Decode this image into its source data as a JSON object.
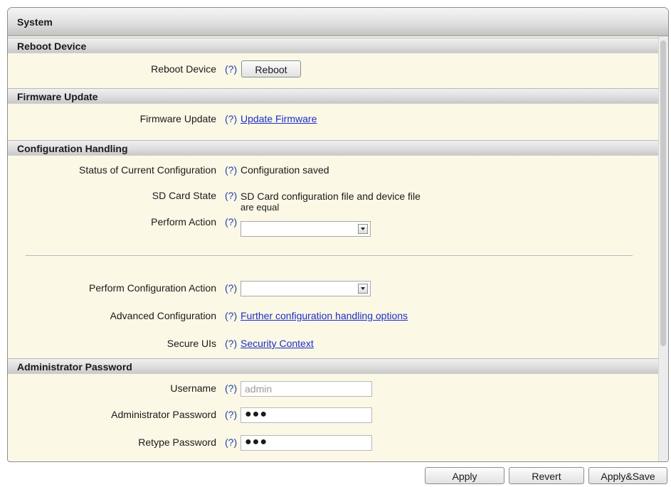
{
  "panel": {
    "title": "System"
  },
  "sections": {
    "reboot": {
      "header": "Reboot Device",
      "label": "Reboot Device",
      "help": "(?)",
      "button": "Reboot"
    },
    "firmware": {
      "header": "Firmware Update",
      "label": "Firmware Update",
      "help": "(?)",
      "link": "Update Firmware"
    },
    "config": {
      "header": "Configuration Handling",
      "status_label": "Status of Current Configuration",
      "status_help": "(?)",
      "status_value": "Configuration saved",
      "sd_label": "SD Card State",
      "sd_help": "(?)",
      "sd_value_line1": "SD Card configuration file and device file",
      "sd_value_line2": "are equal",
      "perform_label": "Perform Action",
      "perform_help": "(?)",
      "perform_value": "",
      "perform_config_label": "Perform Configuration Action",
      "perform_config_help": "(?)",
      "perform_config_value": "",
      "advanced_label": "Advanced Configuration",
      "advanced_help": "(?)",
      "advanced_link": "Further configuration handling options",
      "secure_label": "Secure UIs",
      "secure_help": "(?)",
      "secure_link": "Security Context"
    },
    "admin": {
      "header": "Administrator Password",
      "username_label": "Username",
      "username_help": "(?)",
      "username_value": "admin",
      "password_label": "Administrator Password",
      "password_help": "(?)",
      "password_value": "●●●",
      "retype_label": "Retype Password",
      "retype_help": "(?)",
      "retype_value": "●●●"
    }
  },
  "footer": {
    "apply": "Apply",
    "revert": "Revert",
    "apply_save": "Apply&Save"
  },
  "icons": {
    "dropdown": "chevron-down-icon"
  },
  "colors": {
    "panel_background": "#fbf8e6",
    "link": "#1c2ec7",
    "help": "#1f3fb0"
  }
}
